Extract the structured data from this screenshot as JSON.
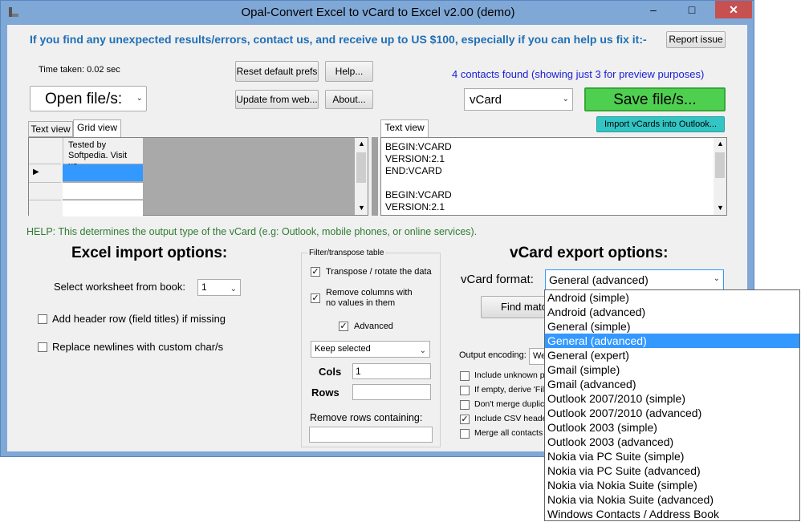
{
  "window": {
    "title": "Opal-Convert Excel to vCard to Excel v2.00 (demo)",
    "minimize": "–",
    "maximize": "□",
    "close": "✕"
  },
  "header": {
    "notice": "If you find any unexpected results/errors, contact us, and receive up to US $100, especially if you can help us fix it:-",
    "report_button": "Report issue"
  },
  "top": {
    "time_taken": "Time taken: 0.02 sec",
    "reset_button": "Reset default prefs",
    "help_button": "Help...",
    "update_button": "Update from web...",
    "about_button": "About...",
    "open_button": "Open file/s:",
    "contacts_found": "4 contacts found (showing just 3 for preview purposes)",
    "output_type": "vCard",
    "save_button": "Save file/s...",
    "import_outlook_button": "Import vCards into Outlook..."
  },
  "left_panel": {
    "tabs": [
      "Text view",
      "Grid view"
    ],
    "grid_cell": "Tested by Softpedia. Visit us",
    "row_marker": "▶"
  },
  "right_panel": {
    "tab": "Text view",
    "lines": [
      "BEGIN:VCARD",
      "VERSION:2.1",
      "END:VCARD",
      "",
      "BEGIN:VCARD",
      "VERSION:2.1"
    ]
  },
  "help_text": "HELP: This determines the output type of the vCard (e.g: Outlook, mobile phones, or online services).",
  "excel_import": {
    "title": "Excel import options:",
    "worksheet_label": "Select worksheet from book:",
    "worksheet_value": "1",
    "add_header_label": "Add header row (field titles) if missing",
    "replace_newlines_label": "Replace newlines with custom char/s"
  },
  "filter": {
    "group_title": "Filter/transpose table",
    "transpose_label": "Transpose / rotate the data",
    "remove_columns_label_1": "Remove columns with",
    "remove_columns_label_2": "no values in them",
    "advanced_label": "Advanced",
    "keep_selected": "Keep selected",
    "cols_label": "Cols",
    "cols_value": "1",
    "rows_label": "Rows",
    "rows_value": "",
    "remove_rows_label": "Remove rows containing:",
    "remove_rows_value": ""
  },
  "vcard_export": {
    "title": "vCard export options:",
    "format_label": "vCard format:",
    "format_value": "General (advanced)",
    "find_matches_button": "Find matc",
    "output_encoding_label": "Output encoding:",
    "output_encoding_value": "We",
    "include_unknown_label": "Include unknown p",
    "if_empty_label": "If empty, derive 'File",
    "dont_merge_label": "Don't merge duplic",
    "include_csv_label": "Include CSV heade",
    "merge_all_label": "Merge all contacts"
  },
  "format_options": [
    "Android (simple)",
    "Android (advanced)",
    "General (simple)",
    "General (advanced)",
    "General (expert)",
    "Gmail (simple)",
    "Gmail (advanced)",
    "Outlook 2007/2010 (simple)",
    "Outlook 2007/2010 (advanced)",
    "Outlook 2003 (simple)",
    "Outlook 2003 (advanced)",
    "Nokia via PC Suite (simple)",
    "Nokia via PC Suite (advanced)",
    "Nokia via Nokia Suite (simple)",
    "Nokia via Nokia Suite (advanced)",
    "Windows Contacts / Address Book"
  ],
  "selected_format_index": 3,
  "colors": {
    "notice": "#1f6fb5",
    "contacts_found": "#1b1bd6",
    "help": "#2e7d32",
    "save_green": "#4fcf4f",
    "import_teal": "#33c4c4",
    "selection": "#3399ff"
  }
}
